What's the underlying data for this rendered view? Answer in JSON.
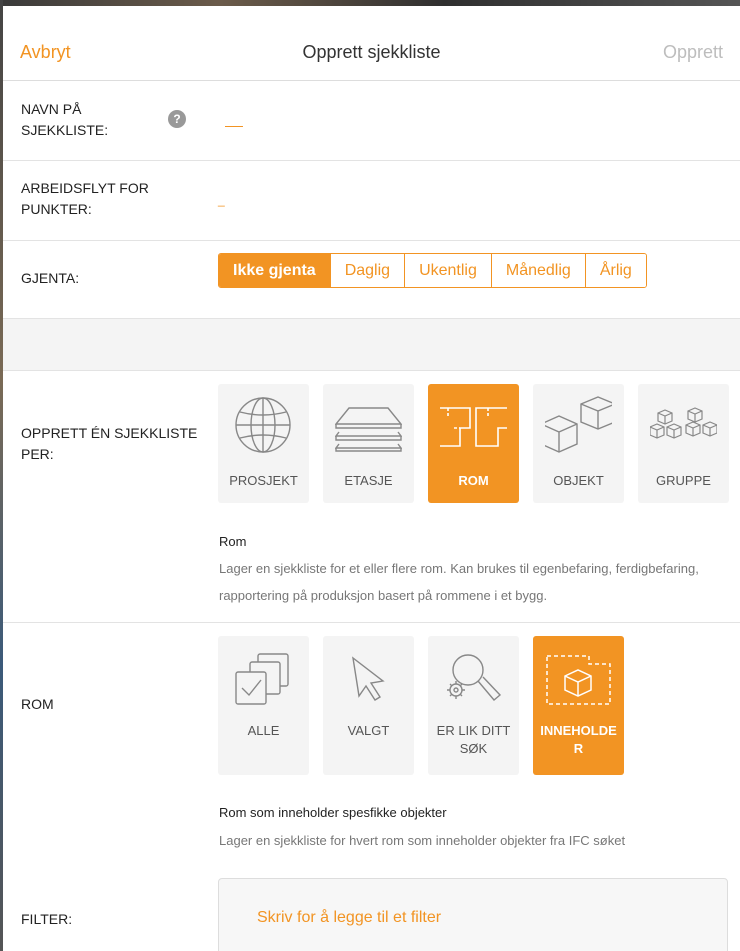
{
  "header": {
    "cancel_label": "Avbryt",
    "title": "Opprett sjekkliste",
    "create_label": "Opprett"
  },
  "name_row": {
    "label": "NAVN PÅ SJEKKLISTE:",
    "help_icon": "question-icon",
    "help_glyph": "?",
    "value": "__"
  },
  "flow_row": {
    "label": "ARBEIDSFLYT FOR PUNKTER:",
    "value": "_"
  },
  "repeat_row": {
    "label": "GJENTA:",
    "options": [
      "Ikke gjenta",
      "Daglig",
      "Ukentlig",
      "Månedlig",
      "Årlig"
    ],
    "selected": "Ikke gjenta"
  },
  "per_row": {
    "label": "OPPRETT ÉN SJEKKLISTE PER:",
    "tiles": [
      {
        "label": "PROSJEKT",
        "icon": "globe-icon"
      },
      {
        "label": "ETASJE",
        "icon": "layers-icon"
      },
      {
        "label": "ROM",
        "icon": "rooms-icon"
      },
      {
        "label": "OBJEKT",
        "icon": "cubes-icon"
      },
      {
        "label": "GRUPPE",
        "icon": "cube-group-icon"
      }
    ],
    "selected": "ROM",
    "description_title": "Rom",
    "description_text": "Lager en sjekkliste for et eller flere rom. Kan brukes til egenbefaring, ferdigbefaring, rapportering på produksjon basert på rommene i et bygg."
  },
  "rom_row": {
    "label": "ROM",
    "tiles": [
      {
        "label": "ALLE",
        "icon": "select-all-icon"
      },
      {
        "label": "VALGT",
        "icon": "cursor-icon"
      },
      {
        "label": "ER LIK DITT SØK",
        "icon": "search-gear-icon"
      },
      {
        "label": "INNEHOLDER",
        "icon": "contains-cube-icon"
      }
    ],
    "selected": "INNEHOLDER",
    "description_title": "Rom som inneholder spesfikke objekter",
    "description_text": "Lager en sjekkliste for hvert rom som inneholder objekter fra IFC søket"
  },
  "filter_row": {
    "label": "FILTER:",
    "placeholder": "Skriv for å legge til et filter"
  },
  "colors": {
    "accent": "#f29423",
    "disabled": "#bdbdbd",
    "tile_bg": "#f4f4f4"
  }
}
